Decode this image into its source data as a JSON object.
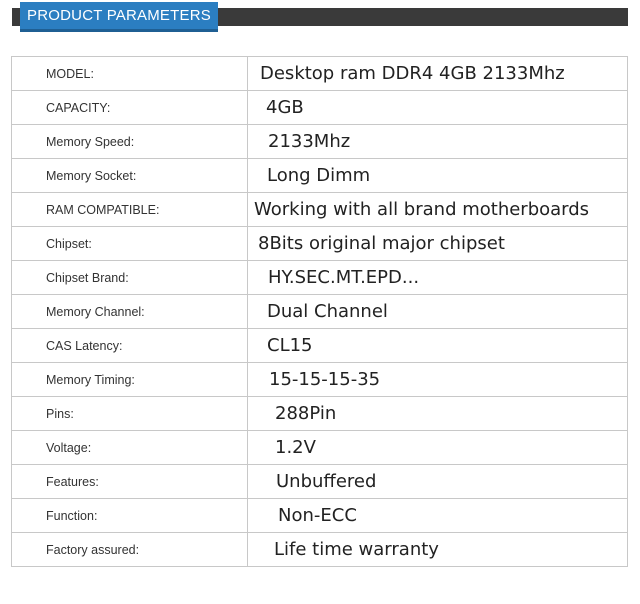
{
  "header": {
    "title": "PRODUCT PARAMETERS"
  },
  "parameters": [
    {
      "label": "MODEL:",
      "value": "Desktop ram DDR4 4GB 2133Mhz"
    },
    {
      "label": "CAPACITY:",
      "value": "4GB"
    },
    {
      "label": "Memory Speed:",
      "value": "2133Mhz"
    },
    {
      "label": "Memory Socket:",
      "value": "Long Dimm"
    },
    {
      "label": "RAM COMPATIBLE:",
      "value": "Working with all brand motherboards"
    },
    {
      "label": "Chipset:",
      "value": "8Bits original major chipset"
    },
    {
      "label": "Chipset Brand:",
      "value": "HY.SEC.MT.EPD..."
    },
    {
      "label": "Memory Channel:",
      "value": "Dual Channel"
    },
    {
      "label": "CAS Latency:",
      "value": "CL15"
    },
    {
      "label": "Memory Timing:",
      "value": "15-15-15-35"
    },
    {
      "label": "Pins:",
      "value": "288Pin"
    },
    {
      "label": "Voltage:",
      "value": "1.2V"
    },
    {
      "label": "Features:",
      "value": "Unbuffered"
    },
    {
      "label": "Function:",
      "value": "Non-ECC"
    },
    {
      "label": "Factory assured:",
      "value": "Life time warranty"
    }
  ],
  "colors": {
    "header_tab": "#2b7ec1",
    "header_bar": "#3a3a3a",
    "border": "#c8c8c8"
  }
}
